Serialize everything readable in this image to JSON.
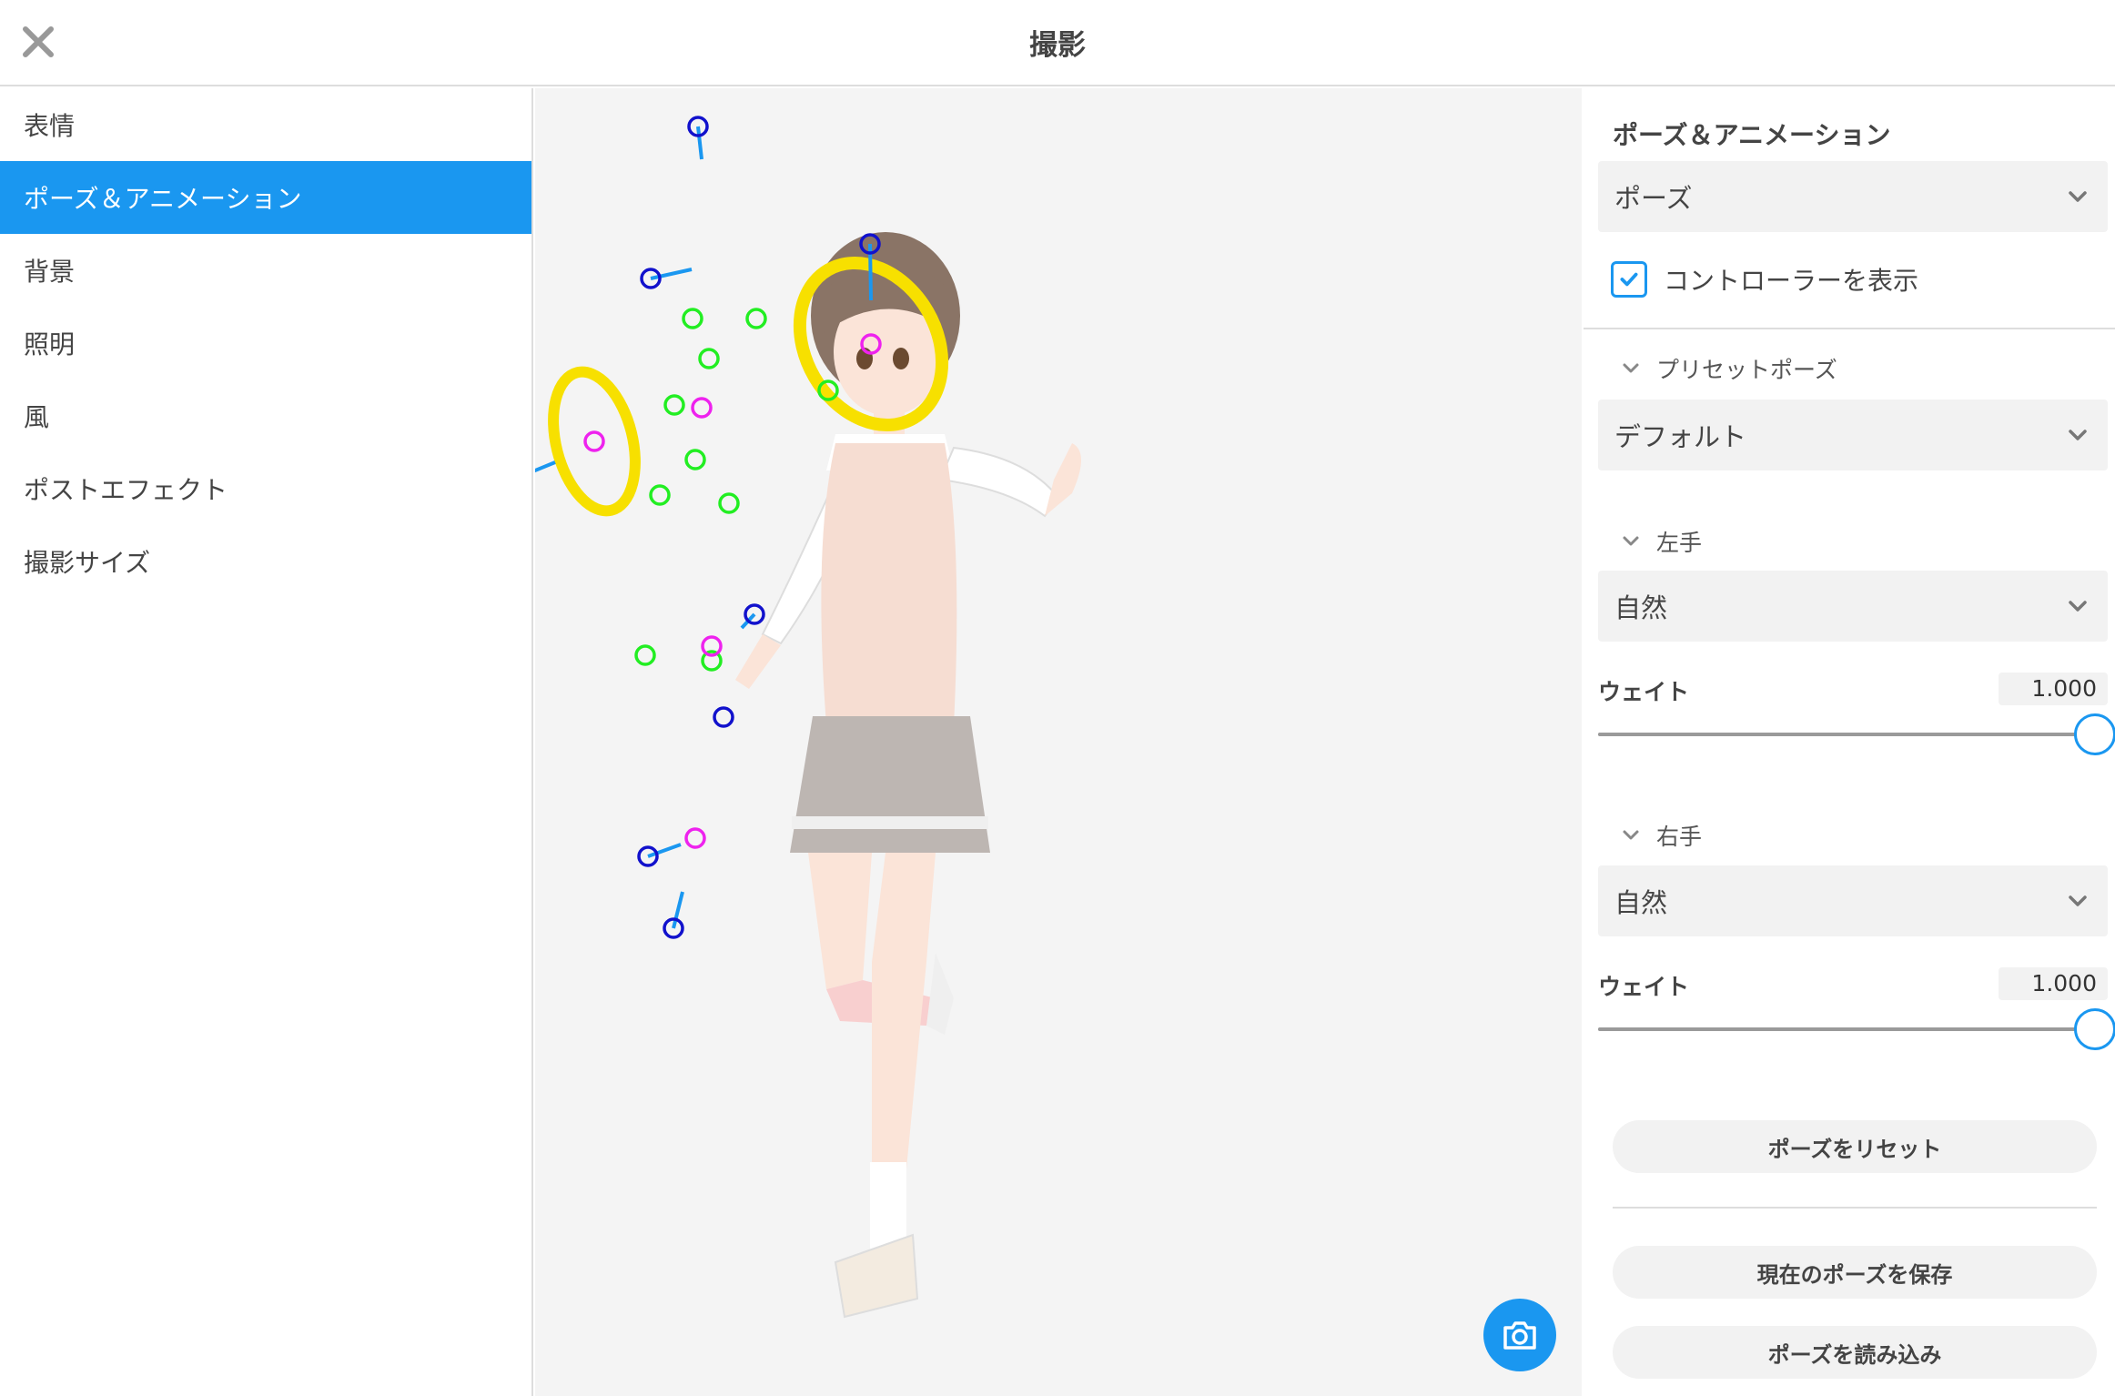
{
  "header": {
    "title": "撮影",
    "close_icon": "close-icon"
  },
  "sidebar": {
    "items": [
      {
        "label": "表情",
        "active": false
      },
      {
        "label": "ポーズ＆アニメーション",
        "active": true
      },
      {
        "label": "背景",
        "active": false
      },
      {
        "label": "照明",
        "active": false
      },
      {
        "label": "風",
        "active": false
      },
      {
        "label": "ポストエフェクト",
        "active": false
      },
      {
        "label": "撮影サイズ",
        "active": false
      }
    ]
  },
  "viewport": {
    "camera_icon": "camera-icon"
  },
  "panel": {
    "title": "ポーズ＆アニメーション",
    "mode_select": {
      "value": "ポーズ"
    },
    "show_controller": {
      "label": "コントローラーを表示",
      "checked": true
    },
    "preset": {
      "header": "プリセットポーズ",
      "value": "デフォルト"
    },
    "left_hand": {
      "header": "左手",
      "value": "自然",
      "weight_label": "ウェイト",
      "weight_value": "1.000",
      "weight": 1.0
    },
    "right_hand": {
      "header": "右手",
      "value": "自然",
      "weight_label": "ウェイト",
      "weight_value": "1.000",
      "weight": 1.0
    },
    "buttons": {
      "reset": "ポーズをリセット",
      "save": "現在のポーズを保存",
      "load": "ポーズを読み込み"
    }
  },
  "colors": {
    "accent": "#1a97f0",
    "controller_fk": "#22ee22",
    "controller_ik": "#ee22ee",
    "controller_pole": "#1111cc",
    "rotation_ring": "#f7e000"
  }
}
